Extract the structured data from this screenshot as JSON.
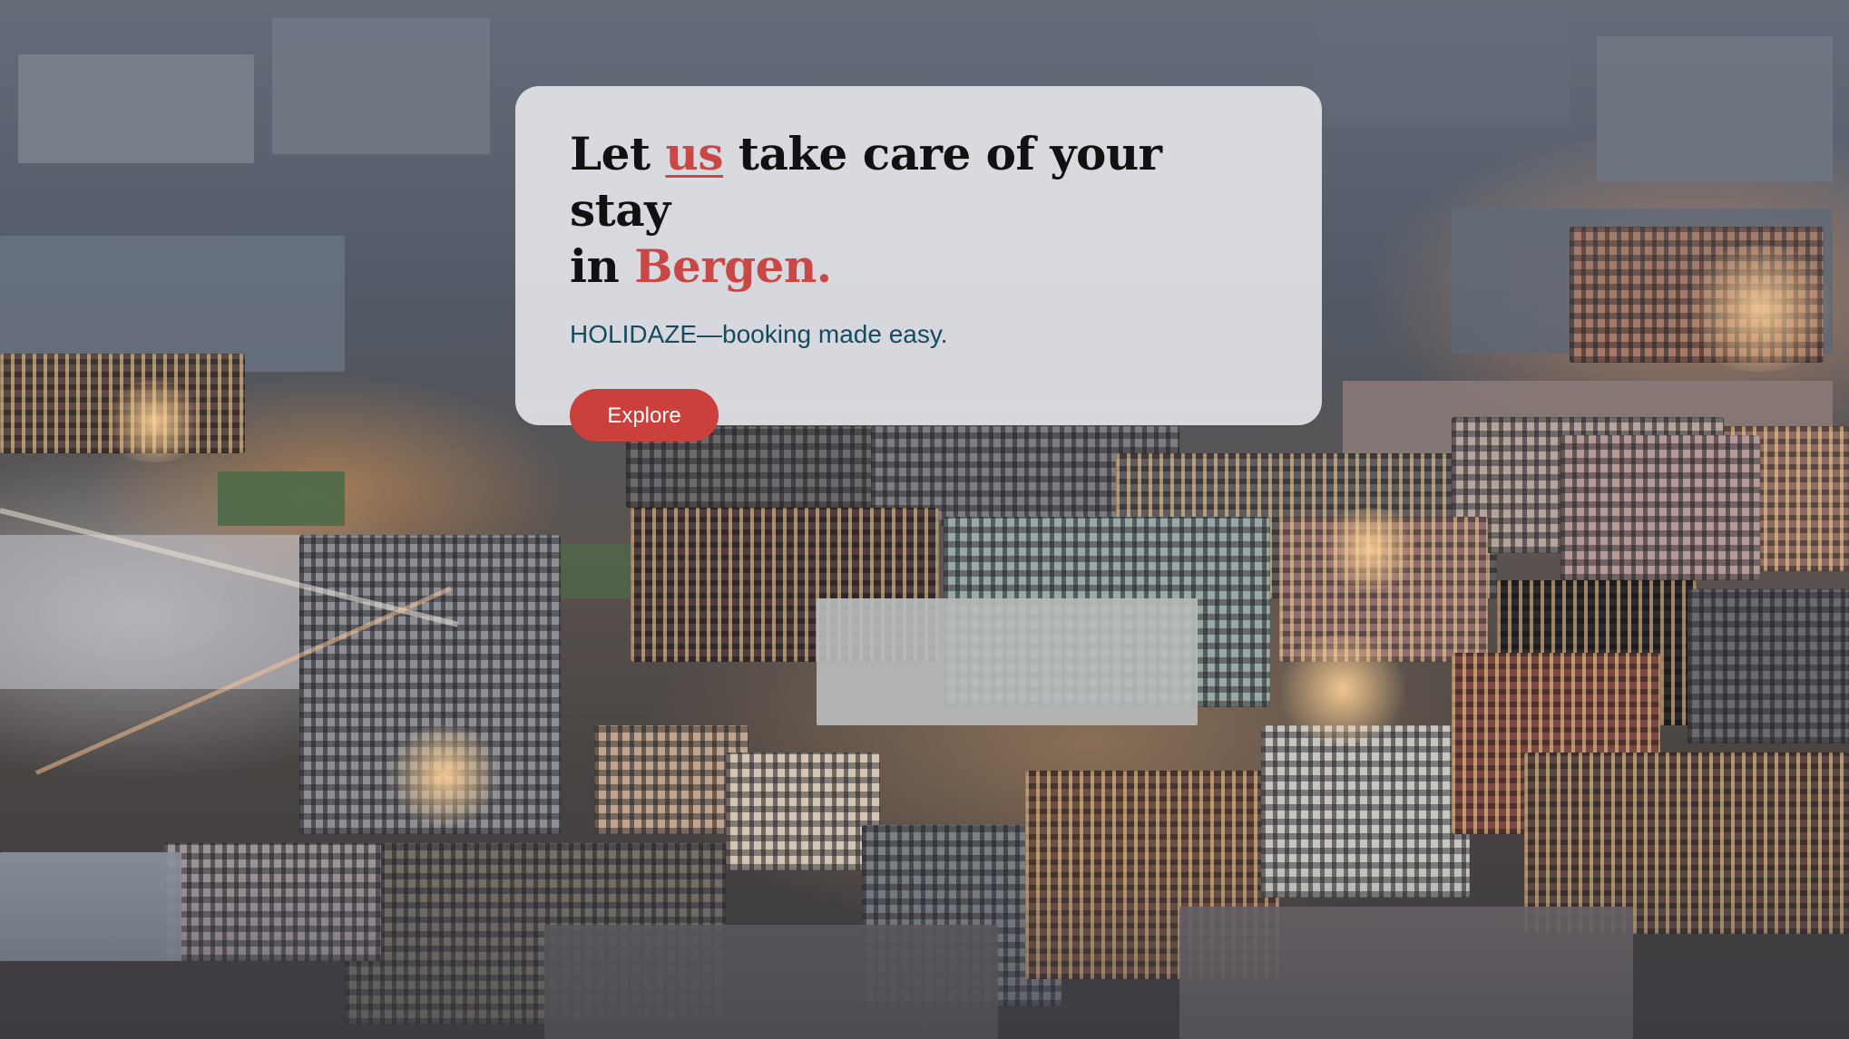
{
  "hero": {
    "background_description_icon": "city-aerial-photo",
    "headline": {
      "part1": "Let ",
      "highlight_us": "us",
      "part2": " take care of your stay",
      "part3": "in ",
      "highlight_city": "Bergen."
    },
    "tagline": "HOLIDAZE—booking made easy.",
    "cta_label": "Explore"
  },
  "colors": {
    "accent": "#c94744",
    "button": "#c9403d",
    "tagline": "#164a5e",
    "headline": "#111111",
    "card_background": "#eeeef2"
  }
}
